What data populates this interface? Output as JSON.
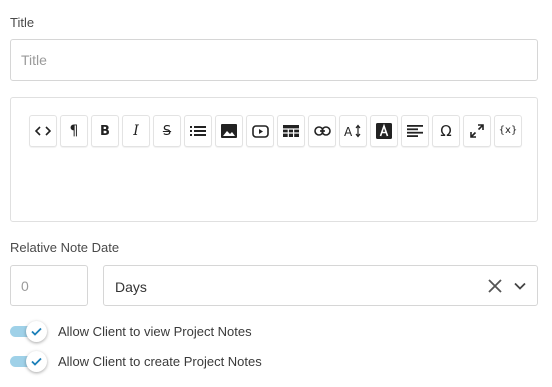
{
  "title_field": {
    "label": "Title",
    "placeholder": "Title",
    "value": ""
  },
  "editor": {
    "toolbar": [
      {
        "name": "code-view-button",
        "icon": "code-icon"
      },
      {
        "name": "paragraph-button",
        "icon": "paragraph-icon",
        "glyph": "¶"
      },
      {
        "name": "bold-button",
        "icon": "bold-icon",
        "glyph": "B"
      },
      {
        "name": "italic-button",
        "icon": "italic-icon",
        "glyph": "I"
      },
      {
        "name": "strikethrough-button",
        "icon": "strikethrough-icon",
        "glyph": "S"
      },
      {
        "name": "bulleted-list-button",
        "icon": "list-icon"
      },
      {
        "name": "insert-image-button",
        "icon": "image-icon"
      },
      {
        "name": "insert-video-button",
        "icon": "video-icon"
      },
      {
        "name": "insert-table-button",
        "icon": "table-icon"
      },
      {
        "name": "insert-link-button",
        "icon": "link-icon"
      },
      {
        "name": "font-size-button",
        "icon": "font-size-icon"
      },
      {
        "name": "font-color-button",
        "icon": "font-color-icon",
        "glyph": "A"
      },
      {
        "name": "align-button",
        "icon": "align-left-icon"
      },
      {
        "name": "special-chars-button",
        "icon": "omega-icon",
        "glyph": "Ω"
      },
      {
        "name": "fullscreen-button",
        "icon": "fullscreen-icon"
      },
      {
        "name": "variables-button",
        "icon": "variable-icon",
        "glyph": "{x}"
      }
    ]
  },
  "relative_date": {
    "label": "Relative Note Date",
    "number_placeholder": "0",
    "unit_value": "Days"
  },
  "toggles": [
    {
      "label": "Allow Client to view Project Notes",
      "checked": true
    },
    {
      "label": "Allow Client to create Project Notes",
      "checked": true
    }
  ],
  "colors": {
    "toggle_track": "#9fd1e8",
    "check": "#1a7fb8"
  }
}
